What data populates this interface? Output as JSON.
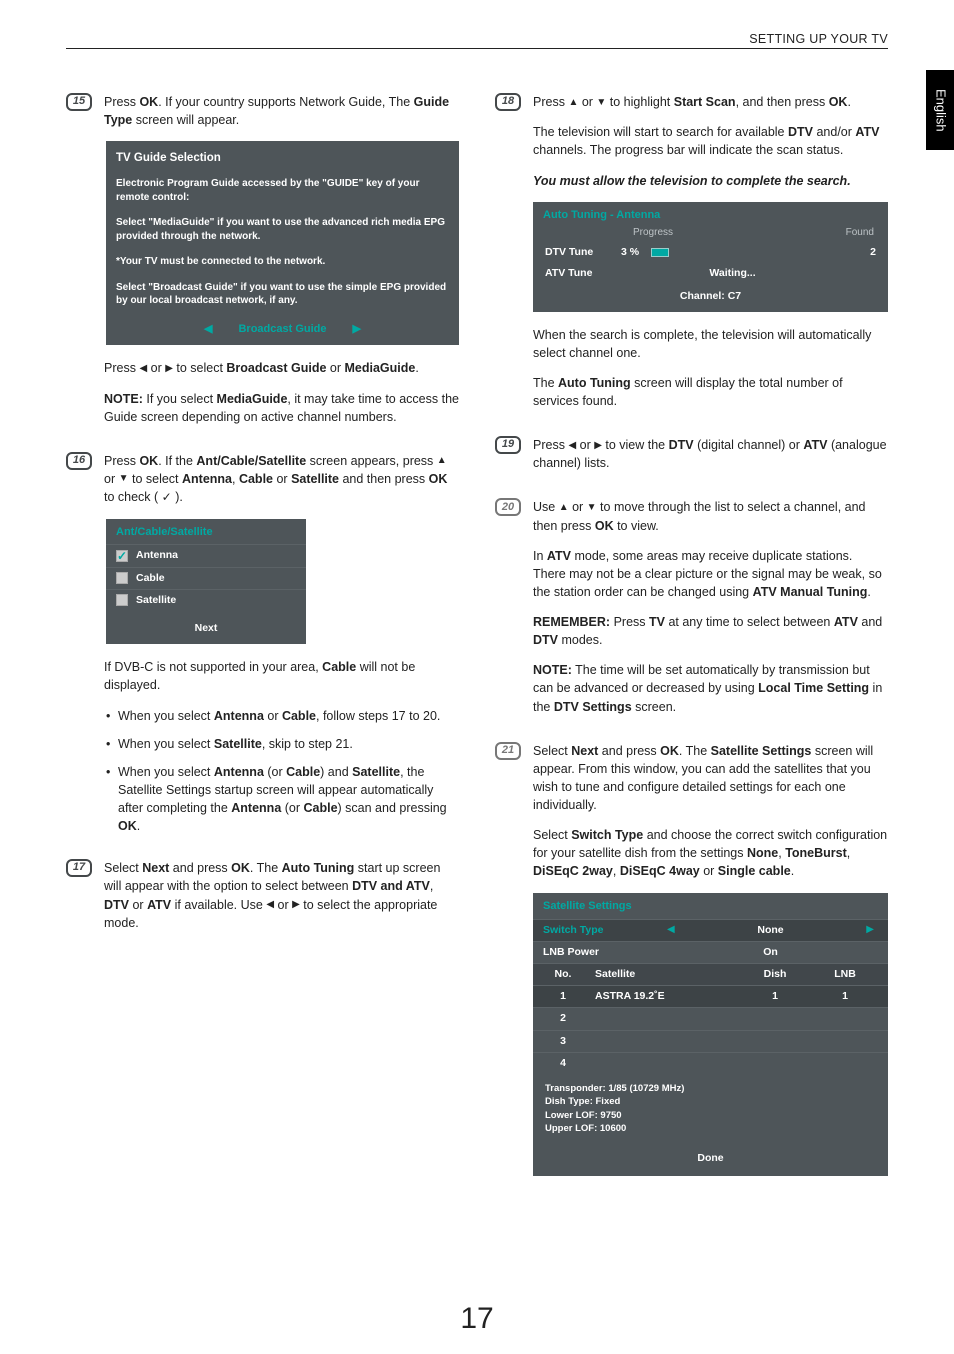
{
  "header": {
    "section": "SETTING UP YOUR TV",
    "language": "English"
  },
  "pageNumber": "17",
  "left": {
    "s15": {
      "num": "15",
      "p1_a": "Press ",
      "p1_b": "OK",
      "p1_c": ". If your country supports Network Guide, The ",
      "p1_d": "Guide Type",
      "p1_e": " screen will appear.",
      "panel": {
        "title": "TV Guide Selection",
        "line1": "Electronic Program Guide accessed by the \"GUIDE\" key of your remote control:",
        "line2": "Select \"MediaGuide\" if you want to use the advanced rich media EPG provided through the network.",
        "line3": "*Your TV must be connected to the network.",
        "line4": "Select \"Broadcast Guide\" if you want to use the simple EPG provided by our local broadcast network, if any.",
        "nav": "Broadcast Guide"
      },
      "p2_a": "Press ",
      "p2_b": " or ",
      "p2_c": " to select ",
      "p2_d": "Broadcast Guide",
      "p2_e": " or ",
      "p2_f": "MediaGuide",
      "p2_g": ".",
      "note_a": "NOTE:",
      "note_b": " If you select ",
      "note_c": "MediaGuide",
      "note_d": ", it may take time to access the Guide screen depending on active channel numbers."
    },
    "s16": {
      "num": "16",
      "p1_a": "Press ",
      "p1_b": "OK",
      "p1_c": ". If the ",
      "p1_d": "Ant/Cable/Satellite",
      "p1_e": " screen appears, press ",
      "p1_f": " or ",
      "p1_g": " to select ",
      "p1_h": "Antenna",
      "p1_i": ", ",
      "p1_j": "Cable",
      "p1_k": " or ",
      "p1_l": "Satellite",
      "p1_m": " and then press ",
      "p1_n": "OK",
      "p1_o": " to check ( ",
      "p1_p": " ).",
      "panel": {
        "title": "Ant/Cable/Satellite",
        "item1": "Antenna",
        "item2": "Cable",
        "item3": "Satellite",
        "next": "Next"
      },
      "p2_a": "If DVB-C is not supported in your area, ",
      "p2_b": "Cable",
      "p2_c": " will not be displayed.",
      "b1_a": "When you select ",
      "b1_b": "Antenna",
      "b1_c": " or ",
      "b1_d": "Cable",
      "b1_e": ", follow steps 17 to 20.",
      "b2_a": "When you select ",
      "b2_b": "Satellite",
      "b2_c": ", skip to step 21.",
      "b3_a": "When you select ",
      "b3_b": "Antenna",
      "b3_c": " (or ",
      "b3_d": "Cable",
      "b3_e": ") and ",
      "b3_f": "Satellite",
      "b3_g": ", the Satellite Settings startup screen will appear automatically after completing the ",
      "b3_h": "Antenna",
      "b3_i": " (or ",
      "b3_j": "Cable",
      "b3_k": ") scan and pressing ",
      "b3_l": "OK",
      "b3_m": "."
    },
    "s17": {
      "num": "17",
      "p1_a": "Select ",
      "p1_b": "Next",
      "p1_c": " and press ",
      "p1_d": "OK",
      "p1_e": ". The ",
      "p1_f": "Auto Tuning",
      "p1_g": " start up screen will appear with the option to select between ",
      "p1_h": "DTV and ATV",
      "p1_i": ", ",
      "p1_j": "DTV",
      "p1_k": " or ",
      "p1_l": "ATV",
      "p1_m": " if available. Use ",
      "p1_n": " or ",
      "p1_o": " to select the appropriate mode."
    }
  },
  "right": {
    "s18": {
      "num": "18",
      "p1_a": "Press ",
      "p1_b": " or ",
      "p1_c": " to highlight ",
      "p1_d": "Start Scan",
      "p1_e": ", and then press ",
      "p1_f": "OK",
      "p1_g": ".",
      "p2_a": "The television will start to search for available ",
      "p2_b": "DTV",
      "p2_c": " and/or ",
      "p2_d": "ATV",
      "p2_e": " channels. The progress bar will indicate the scan status.",
      "p3": "You must allow the television to complete the search.",
      "panel": {
        "title": "Auto Tuning - Antenna",
        "progress": "Progress",
        "found": "Found",
        "dtv": "DTV Tune",
        "dtvpct": "3 %",
        "dtvfound": "2",
        "atv": "ATV Tune",
        "waiting": "Waiting...",
        "channel": "Channel: C7"
      },
      "p4": "When the search is complete, the television will automatically select channel one.",
      "p5_a": "The ",
      "p5_b": "Auto Tuning",
      "p5_c": " screen will display the total number of services found."
    },
    "s19": {
      "num": "19",
      "p1_a": "Press ",
      "p1_b": " or ",
      "p1_c": " to view the ",
      "p1_d": "DTV",
      "p1_e": " (digital channel) or ",
      "p1_f": "ATV",
      "p1_g": " (analogue channel) lists."
    },
    "s20": {
      "num": "20",
      "p1_a": "Use ",
      "p1_b": " or ",
      "p1_c": " to move through the list to select a channel, and then press ",
      "p1_d": "OK",
      "p1_e": " to view.",
      "p2_a": "In ",
      "p2_b": "ATV",
      "p2_c": " mode, some areas may receive duplicate stations. There may not be a clear picture or the signal may be weak, so the station order can be changed using ",
      "p2_d": "ATV Manual Tuning",
      "p2_e": ".",
      "p3_a": "REMEMBER:",
      "p3_b": " Press ",
      "p3_c": "TV",
      "p3_d": " at any time to select between ",
      "p3_e": "ATV",
      "p3_f": " and ",
      "p3_g": "DTV",
      "p3_h": " modes.",
      "p4_a": "NOTE:",
      "p4_b": " The time will be set automatically by transmission but can be advanced or decreased by using ",
      "p4_c": "Local Time Setting",
      "p4_d": " in the ",
      "p4_e": "DTV Settings",
      "p4_f": " screen."
    },
    "s21": {
      "num": "21",
      "p1_a": "Select ",
      "p1_b": "Next",
      "p1_c": " and press ",
      "p1_d": "OK",
      "p1_e": ". The ",
      "p1_f": "Satellite Settings",
      "p1_g": " screen will appear. From this window, you can add the satellites that you wish to tune and configure detailed settings for each one individually.",
      "p2_a": "Select ",
      "p2_b": "Switch Type",
      "p2_c": " and choose the correct switch configuration for your satellite dish from the settings ",
      "p2_d": "None",
      "p2_e": ", ",
      "p2_f": "ToneBurst",
      "p2_g": ", ",
      "p2_h": "DiSEqC 2way",
      "p2_i": ", ",
      "p2_j": "DiSEqC 4way",
      "p2_k": " or ",
      "p2_l": "Single cable",
      "p2_m": ".",
      "panel": {
        "title": "Satellite Settings",
        "switch": "Switch Type",
        "switchVal": "None",
        "lnb": "LNB Power",
        "lnbVal": "On",
        "hNo": "No.",
        "hSat": "Satellite",
        "hDish": "Dish",
        "hLnb": "LNB",
        "r1no": "1",
        "r1sat": "ASTRA 19.2˚E",
        "r1dish": "1",
        "r1lnb": "1",
        "r2": "2",
        "r3": "3",
        "r4": "4",
        "info1": "Transponder: 1/85 (10729 MHz)",
        "info2": "Dish Type: Fixed",
        "info3": "Lower LOF: 9750",
        "info4": "Upper LOF: 10600",
        "done": "Done"
      }
    }
  }
}
